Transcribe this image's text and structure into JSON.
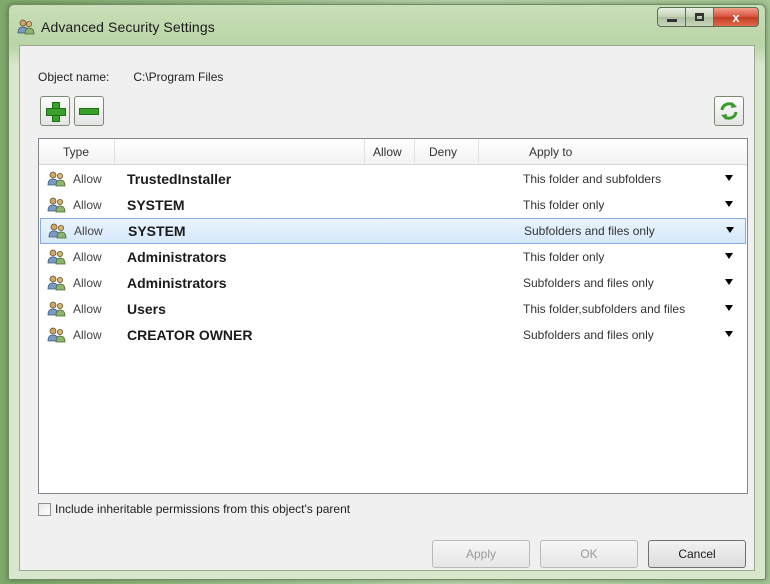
{
  "window": {
    "title": "Advanced Security Settings",
    "caption_close": "x"
  },
  "object": {
    "label": "Object name:",
    "value": "C:\\Program Files"
  },
  "columns": {
    "type": "Type",
    "allow": "Allow",
    "deny": "Deny",
    "apply_to": "Apply to"
  },
  "rows": [
    {
      "type": "Allow",
      "name": "TrustedInstaller",
      "apply_to": "This folder and subfolders"
    },
    {
      "type": "Allow",
      "name": "SYSTEM",
      "apply_to": "This folder only"
    },
    {
      "type": "Allow",
      "name": "SYSTEM",
      "apply_to": "Subfolders and files only",
      "selected": true
    },
    {
      "type": "Allow",
      "name": "Administrators",
      "apply_to": "This folder only"
    },
    {
      "type": "Allow",
      "name": "Administrators",
      "apply_to": "Subfolders and files only"
    },
    {
      "type": "Allow",
      "name": "Users",
      "apply_to": "This folder,subfolders and files"
    },
    {
      "type": "Allow",
      "name": "CREATOR OWNER",
      "apply_to": "Subfolders and files only"
    }
  ],
  "inherit_checkbox": {
    "label": "Include inheritable permissions from this object's parent",
    "checked": false
  },
  "buttons": {
    "apply": "Apply",
    "ok": "OK",
    "cancel": "Cancel"
  },
  "colors": {
    "accent_green": "#39a02c",
    "selection_border": "#84acdd",
    "close_red": "#c43a22"
  },
  "icons": {
    "title": "security-shield-users-icon",
    "add": "plus-icon",
    "remove": "minus-icon",
    "refresh": "refresh-icon",
    "row": "users-icon",
    "dropdown": "dropdown-arrow-icon"
  }
}
